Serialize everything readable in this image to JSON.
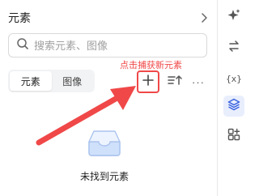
{
  "panel": {
    "title": "元素",
    "search": {
      "placeholder": "搜索元素、图像"
    },
    "tabs": [
      {
        "label": "元素",
        "active": true
      },
      {
        "label": "图像",
        "active": false
      }
    ],
    "hint": "点击捕获新元素",
    "more_label": "···",
    "empty_text": "未找到元素"
  },
  "rail": {
    "items": [
      {
        "icon": "sparkle-icon"
      },
      {
        "icon": "swap-icon"
      },
      {
        "icon": "variable-icon",
        "label": "{x}"
      },
      {
        "icon": "layers-icon",
        "active": true
      },
      {
        "icon": "grid-plus-icon"
      }
    ]
  },
  "colors": {
    "accent_red": "#f04848",
    "active_blue": "#3a63e0",
    "active_bg": "#e8eefc"
  }
}
